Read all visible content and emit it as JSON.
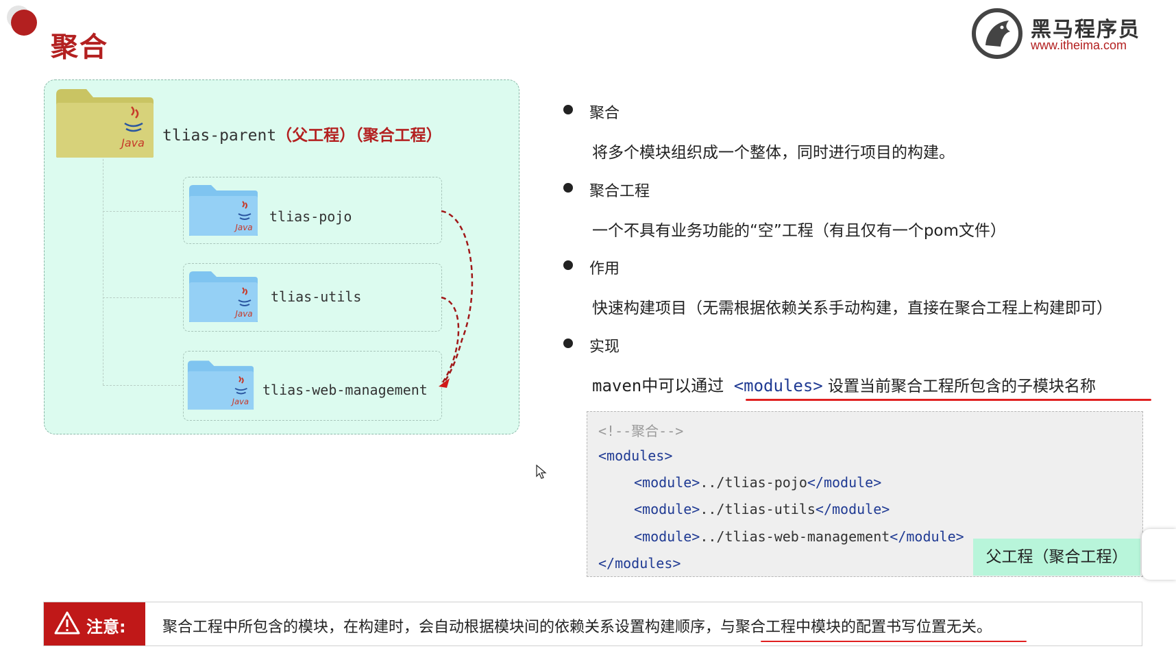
{
  "header": {
    "title": "聚合",
    "logo_name": "黑马程序员",
    "logo_url": "www.itheima.com"
  },
  "diagram": {
    "parent": {
      "name": "tlias-parent",
      "tag": "（父工程）（聚合工程）",
      "folder_badge": "Java"
    },
    "children": [
      {
        "name": "tlias-pojo",
        "folder_badge": "Java"
      },
      {
        "name": "tlias-utils",
        "folder_badge": "Java"
      },
      {
        "name": "tlias-web-management",
        "folder_badge": "Java"
      }
    ]
  },
  "bullets": [
    {
      "head": "聚合",
      "body": "将多个模块组织成一个整体，同时进行项目的构建。"
    },
    {
      "head": "聚合工程",
      "body": "一个不具有业务功能的“空”工程（有且仅有一个pom文件）"
    },
    {
      "head": "作用",
      "body": "快速构建项目（无需根据依赖关系手动构建，直接在聚合工程上构建即可）"
    },
    {
      "head": "实现",
      "body_prefix": "maven中可以通过 ",
      "body_code": "<modules>",
      "body_suffix": " 设置当前聚合工程所包含的子模块名称"
    }
  ],
  "code": {
    "comment": "<!--聚合-->",
    "open": "<modules>",
    "lines": [
      {
        "open": "<module>",
        "path": "../tlias-pojo",
        "close": "</module>"
      },
      {
        "open": "<module>",
        "path": "../tlias-utils",
        "close": "</module>"
      },
      {
        "open": "<module>",
        "path": "../tlias-web-management",
        "close": "</module>"
      }
    ],
    "close": "</modules>",
    "overlay_label": "父工程（聚合工程）"
  },
  "note": {
    "label": "注意:",
    "text": "聚合工程中所包含的模块，在构建时，会自动根据模块间的依赖关系设置构建顺序，与聚合工程中模块的配置书写位置无关。"
  },
  "colors": {
    "accent_red": "#b32020",
    "diagram_bg": "#dcfbef",
    "code_bg": "#efefef",
    "tag_blue": "#1f3a93",
    "overlay_green": "#b8f5da"
  }
}
